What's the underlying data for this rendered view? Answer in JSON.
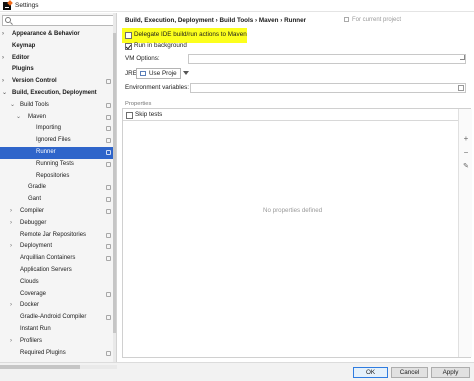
{
  "window": {
    "title": "Settings"
  },
  "search": {
    "value": "",
    "placeholder": ""
  },
  "sidebar": {
    "items": [
      {
        "label": "Appearance & Behavior",
        "level": 0,
        "bold": true,
        "arrow": "›",
        "badge": false,
        "selected": false
      },
      {
        "label": "Keymap",
        "level": 0,
        "bold": true,
        "arrow": "",
        "badge": false,
        "selected": false
      },
      {
        "label": "Editor",
        "level": 0,
        "bold": true,
        "arrow": "›",
        "badge": false,
        "selected": false
      },
      {
        "label": "Plugins",
        "level": 0,
        "bold": true,
        "arrow": "",
        "badge": false,
        "selected": false
      },
      {
        "label": "Version Control",
        "level": 0,
        "bold": true,
        "arrow": "›",
        "badge": true,
        "selected": false
      },
      {
        "label": "Build, Execution, Deployment",
        "level": 0,
        "bold": true,
        "arrow": "⌄",
        "badge": false,
        "selected": false
      },
      {
        "label": "Build Tools",
        "level": 1,
        "bold": false,
        "arrow": "⌄",
        "badge": true,
        "selected": false
      },
      {
        "label": "Maven",
        "level": 2,
        "bold": false,
        "arrow": "⌄",
        "badge": true,
        "selected": false
      },
      {
        "label": "Importing",
        "level": 3,
        "bold": false,
        "arrow": "",
        "badge": true,
        "selected": false
      },
      {
        "label": "Ignored Files",
        "level": 3,
        "bold": false,
        "arrow": "",
        "badge": true,
        "selected": false
      },
      {
        "label": "Runner",
        "level": 3,
        "bold": false,
        "arrow": "",
        "badge": true,
        "selected": true
      },
      {
        "label": "Running Tests",
        "level": 3,
        "bold": false,
        "arrow": "",
        "badge": true,
        "selected": false
      },
      {
        "label": "Repositories",
        "level": 3,
        "bold": false,
        "arrow": "",
        "badge": false,
        "selected": false
      },
      {
        "label": "Gradle",
        "level": 2,
        "bold": false,
        "arrow": "",
        "badge": true,
        "selected": false
      },
      {
        "label": "Gant",
        "level": 2,
        "bold": false,
        "arrow": "",
        "badge": true,
        "selected": false
      },
      {
        "label": "Compiler",
        "level": 1,
        "bold": false,
        "arrow": "›",
        "badge": true,
        "selected": false
      },
      {
        "label": "Debugger",
        "level": 1,
        "bold": false,
        "arrow": "›",
        "badge": false,
        "selected": false
      },
      {
        "label": "Remote Jar Repositories",
        "level": 1,
        "bold": false,
        "arrow": "",
        "badge": true,
        "selected": false
      },
      {
        "label": "Deployment",
        "level": 1,
        "bold": false,
        "arrow": "›",
        "badge": true,
        "selected": false
      },
      {
        "label": "Arquillian Containers",
        "level": 1,
        "bold": false,
        "arrow": "",
        "badge": true,
        "selected": false
      },
      {
        "label": "Application Servers",
        "level": 1,
        "bold": false,
        "arrow": "",
        "badge": false,
        "selected": false
      },
      {
        "label": "Clouds",
        "level": 1,
        "bold": false,
        "arrow": "",
        "badge": false,
        "selected": false
      },
      {
        "label": "Coverage",
        "level": 1,
        "bold": false,
        "arrow": "",
        "badge": true,
        "selected": false
      },
      {
        "label": "Docker",
        "level": 1,
        "bold": false,
        "arrow": "›",
        "badge": false,
        "selected": false
      },
      {
        "label": "Gradle-Android Compiler",
        "level": 1,
        "bold": false,
        "arrow": "",
        "badge": true,
        "selected": false
      },
      {
        "label": "Instant Run",
        "level": 1,
        "bold": false,
        "arrow": "",
        "badge": false,
        "selected": false
      },
      {
        "label": "Profilers",
        "level": 1,
        "bold": false,
        "arrow": "›",
        "badge": false,
        "selected": false
      },
      {
        "label": "Required Plugins",
        "level": 1,
        "bold": false,
        "arrow": "",
        "badge": true,
        "selected": false
      }
    ]
  },
  "header": {
    "breadcrumb": "Build, Execution, Deployment  ›  Build Tools  ›  Maven  ›  Runner",
    "for_current_project": "For current project"
  },
  "runner": {
    "delegate_label": "Delegate IDE build/run actions to Maven",
    "delegate_checked": false,
    "background_label": "Run in background",
    "background_checked": true,
    "vm_options_label": "VM Options:",
    "vm_options_value": "",
    "jre_label": "JRE:",
    "jre_value": "Use Proje",
    "env_label": "Environment variables:",
    "env_value": "",
    "properties_section": "Properties",
    "skip_tests_label": "Skip tests",
    "skip_tests_checked": false,
    "no_properties": "No properties defined"
  },
  "toolbar_icons": [
    "plus-icon",
    "minus-icon",
    "edit-icon"
  ],
  "footer": {
    "ok": "OK",
    "cancel": "Cancel",
    "apply": "Apply"
  },
  "colors": {
    "selection": "#2f65ca",
    "highlight": "#fcff1d",
    "ok_border": "#2f7ce0"
  }
}
